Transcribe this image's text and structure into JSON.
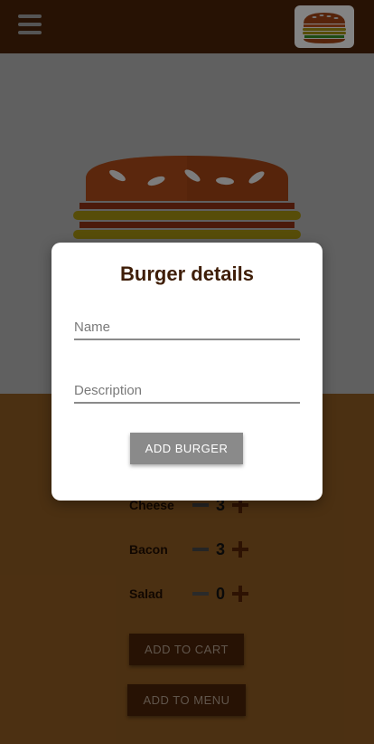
{
  "header": {
    "menu_icon": "hamburger-menu-icon",
    "logo_icon": "burger-logo-icon"
  },
  "ingredients": [
    {
      "label": "Cheese",
      "qty": "3"
    },
    {
      "label": "Bacon",
      "qty": "3"
    },
    {
      "label": "Salad",
      "qty": "0"
    }
  ],
  "actions": {
    "add_to_cart": "ADD TO CART",
    "add_to_menu": "ADD TO MENU"
  },
  "modal": {
    "title": "Burger details",
    "name_placeholder": "Name",
    "description_placeholder": "Description",
    "submit_label": "ADD BURGER"
  },
  "colors": {
    "header": "#3f1e08",
    "preview_bg": "#9b9b9b",
    "body_bg": "#7a4e1d",
    "cheese": "#8d7d10",
    "bun": "#8b3a12"
  }
}
